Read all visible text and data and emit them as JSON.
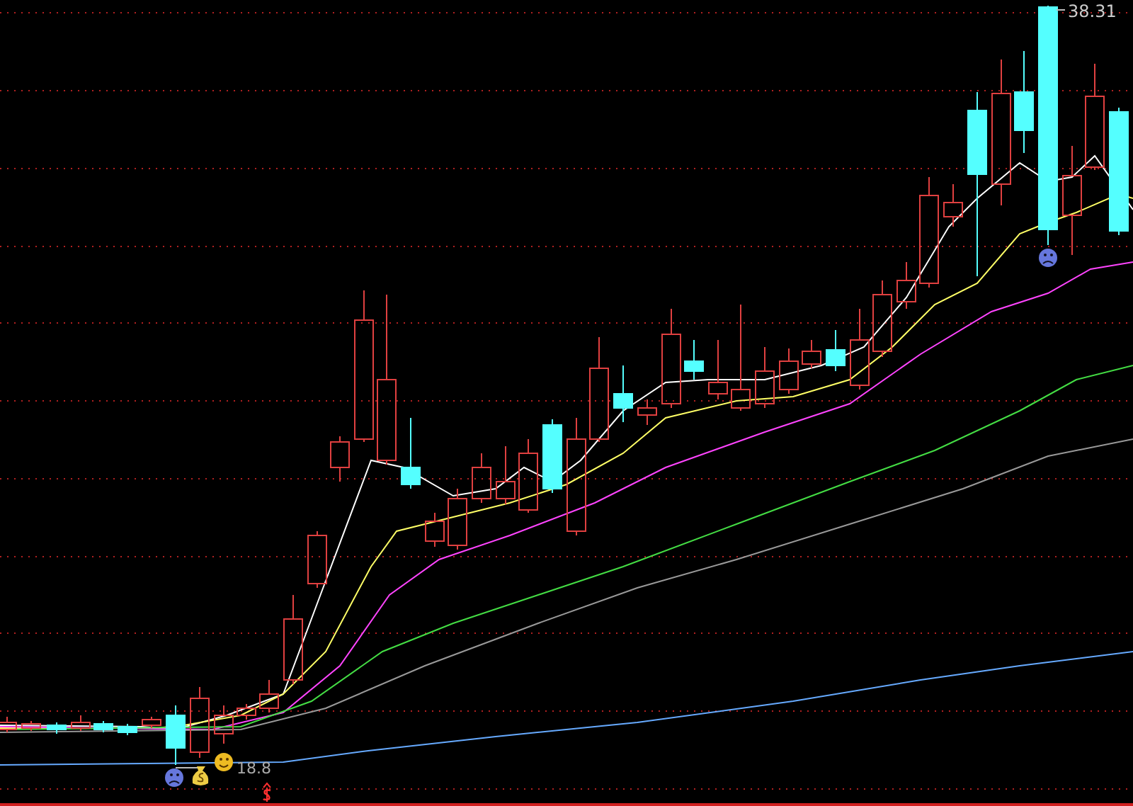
{
  "chart": {
    "high_label": "38.31",
    "low_label": "18.8"
  }
}
